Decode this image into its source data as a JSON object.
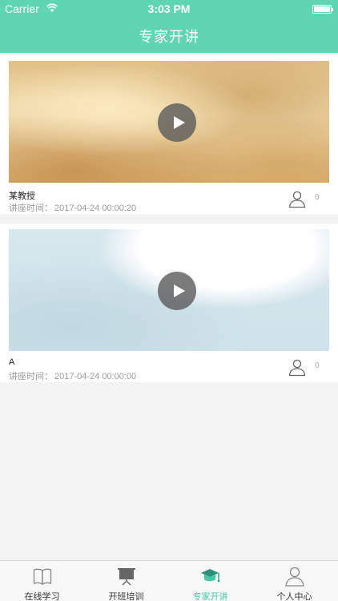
{
  "status_bar": {
    "carrier": "Carrier",
    "time": "3:03 PM"
  },
  "nav": {
    "title": "专家开讲"
  },
  "colors": {
    "accent": "#5fd5b1",
    "tab_active": "#44c8a6",
    "background": "#f3f3f3"
  },
  "lectures": [
    {
      "title": "某教授",
      "date_label": "讲座时间：",
      "date": "2017-04-24 00:00:20",
      "count": "0"
    },
    {
      "title": "A",
      "date_label": "讲座时间：",
      "date": "2017-04-24 00:00:00",
      "count": "0"
    }
  ],
  "tabs": [
    {
      "label": "在线学习",
      "icon": "book-icon"
    },
    {
      "label": "开班培训",
      "icon": "presentation-board-icon"
    },
    {
      "label": "专家开讲",
      "icon": "graduation-cap-icon",
      "active": true
    },
    {
      "label": "个人中心",
      "icon": "person-icon"
    }
  ]
}
